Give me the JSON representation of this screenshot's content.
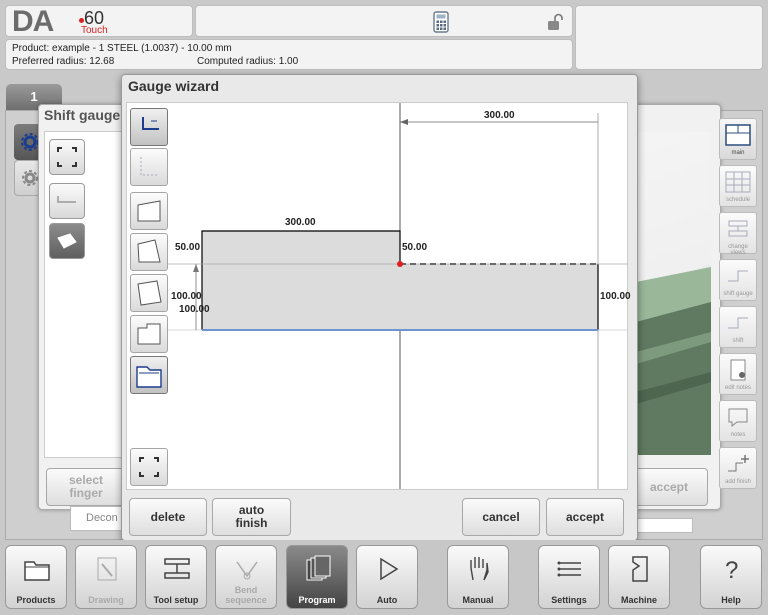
{
  "header": {
    "logo_da": "DA",
    "logo_model": "60",
    "logo_touch": "Touch",
    "calculator_icon": "calculator-icon",
    "lock_icon": "unlocked-padlock-icon"
  },
  "info": {
    "product": "Product: example - 1 STEEL (1.0037) - 10.00 mm",
    "preferred_radius": "Preferred radius: 12.68",
    "computed_radius": "Computed radius: 1.00"
  },
  "tab": {
    "label": "1"
  },
  "background_dialog": {
    "title": "Shift gauge",
    "select_finger": "select\nfinger",
    "accept": "accept",
    "decon_text": "Decon"
  },
  "right_sidebar": {
    "items": [
      {
        "label": "main"
      },
      {
        "label": "schedule"
      },
      {
        "label": "change views"
      },
      {
        "label": "shift gauge"
      },
      {
        "label": "shift"
      },
      {
        "label": "edit notes"
      },
      {
        "label": "notes"
      },
      {
        "label": "add finish"
      }
    ]
  },
  "wizard": {
    "title": "Gauge wizard",
    "dimensions": {
      "top_width": "300.00",
      "left_width": "300.00",
      "left_height_top": "50.00",
      "right_height_top": "50.00",
      "left_height_a": "100.00",
      "left_height_b": "100.00",
      "right_height": "100.00"
    },
    "buttons": {
      "delete": "delete",
      "auto_finish": "auto\nfinish",
      "cancel": "cancel",
      "accept": "accept"
    }
  },
  "nav": {
    "items": [
      {
        "label": "Products",
        "icon": "folder-icon",
        "state": "normal"
      },
      {
        "label": "Drawing",
        "icon": "pencil-icon",
        "state": "disabled"
      },
      {
        "label": "Tool setup",
        "icon": "tool-setup-icon",
        "state": "normal"
      },
      {
        "label": "Bend sequence",
        "icon": "bend-sequence-icon",
        "state": "disabled"
      },
      {
        "label": "Program",
        "icon": "program-pages-icon",
        "state": "active"
      },
      {
        "label": "Auto",
        "icon": "play-icon",
        "state": "normal"
      },
      {
        "label": "Manual",
        "icon": "hand-icon",
        "state": "normal"
      },
      {
        "label": "Settings",
        "icon": "settings-list-icon",
        "state": "normal"
      },
      {
        "label": "Machine",
        "icon": "machine-icon",
        "state": "normal"
      },
      {
        "label": "Help",
        "icon": "help-icon",
        "state": "normal"
      }
    ]
  }
}
